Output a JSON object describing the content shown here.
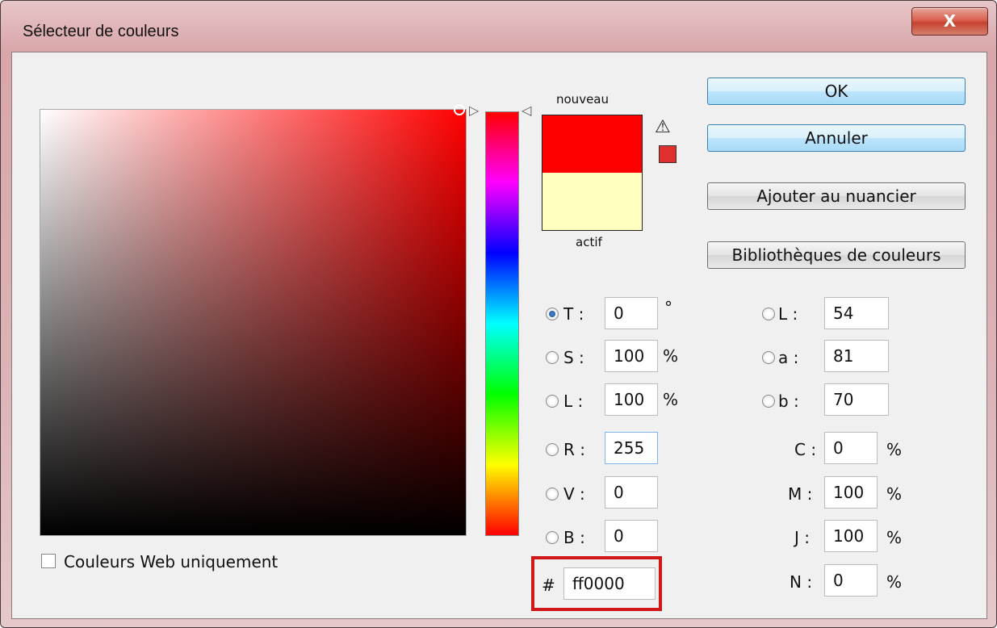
{
  "window": {
    "title": "Sélecteur de couleurs",
    "close_label": "X"
  },
  "preview": {
    "new_label": "nouveau",
    "current_label": "actif",
    "new_color": "#ff0000",
    "current_color": "#ffffc0",
    "warning_icon": "warning-triangle-icon"
  },
  "buttons": {
    "ok": "OK",
    "cancel": "Annuler",
    "add_swatch": "Ajouter au nuancier",
    "libraries": "Bibliothèques de couleurs"
  },
  "hsb": {
    "h": {
      "label": "T :",
      "value": "0",
      "unit": "°",
      "selected": true
    },
    "s": {
      "label": "S :",
      "value": "100",
      "unit": "%"
    },
    "b": {
      "label": "L :",
      "value": "100",
      "unit": "%"
    }
  },
  "rgb": {
    "r": {
      "label": "R :",
      "value": "255"
    },
    "g": {
      "label": "V :",
      "value": "0"
    },
    "b": {
      "label": "B :",
      "value": "0"
    }
  },
  "lab": {
    "l": {
      "label": "L :",
      "value": "54"
    },
    "a": {
      "label": "a :",
      "value": "81"
    },
    "b": {
      "label": "b :",
      "value": "70"
    }
  },
  "cmyk": {
    "c": {
      "label": "C :",
      "value": "0",
      "unit": "%"
    },
    "m": {
      "label": "M :",
      "value": "100",
      "unit": "%"
    },
    "y": {
      "label": "J :",
      "value": "100",
      "unit": "%"
    },
    "k": {
      "label": "N :",
      "value": "0",
      "unit": "%"
    }
  },
  "hex": {
    "label": "#",
    "value": "ff0000"
  },
  "web_only": {
    "label": "Couleurs Web uniquement",
    "checked": false
  },
  "colors": {
    "accent": "#d01818",
    "field_hue": "#ff0000"
  }
}
